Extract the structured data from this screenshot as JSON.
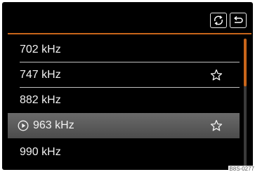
{
  "toolbar": {
    "refresh_icon": "refresh-station-list-icon",
    "back_icon": "back-return-icon"
  },
  "stations": [
    {
      "frequency": "702 kHz",
      "favorite": false,
      "playing": false
    },
    {
      "frequency": "747 kHz",
      "favorite": true,
      "playing": false
    },
    {
      "frequency": "882 kHz",
      "favorite": false,
      "playing": false
    },
    {
      "frequency": "963 kHz",
      "favorite": true,
      "playing": true
    },
    {
      "frequency": "990 kHz",
      "favorite": false,
      "playing": false
    }
  ],
  "scroll": {
    "position_fraction": 0.0,
    "visible_fraction": 0.37
  },
  "colors": {
    "accent": "#c8651a",
    "background": "#000000",
    "selected_row": "#5a5a5a"
  },
  "reference_code": "B8S-0277"
}
